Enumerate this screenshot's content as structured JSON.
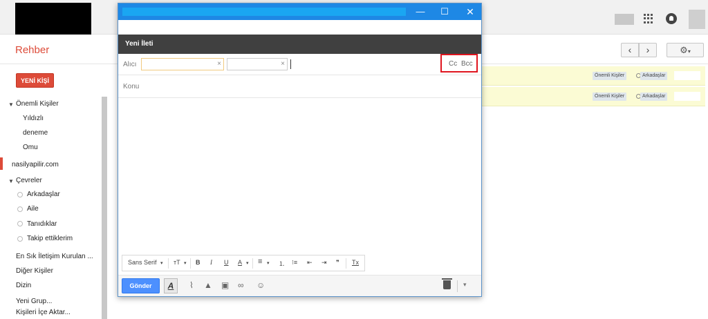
{
  "app": {
    "page_title": "Rehber",
    "new_contact_label": "YENİ KİŞİ"
  },
  "sidebar": {
    "important": {
      "label": "Önemli Kişiler",
      "children": [
        "Yıldızlı",
        "deneme",
        "Omu"
      ]
    },
    "domain_item": "nasilyapilir.com",
    "circles": {
      "label": "Çevreler",
      "children": [
        "Arkadaşlar",
        "Aile",
        "Tanıdıklar",
        "Takip ettiklerim"
      ]
    },
    "bottom_items": [
      "En Sık İletişim Kurulan ...",
      "Diğer Kişiler",
      "Dizin",
      "Yeni Grup...",
      "Kişileri İçe Aktar..."
    ]
  },
  "toolbar": {
    "prev_icon": "‹",
    "next_icon": "›",
    "settings_icon": "gear-icon",
    "settings_caret": "▾"
  },
  "contact_rows": [
    {
      "tags": [
        "Önemli Kişiler",
        "Arkadaşlar"
      ]
    },
    {
      "tags": [
        "Önemli Kişiler",
        "Arkadaşlar"
      ]
    }
  ],
  "compose": {
    "window_controls": {
      "minimize": "—",
      "maximize": "☐",
      "close": "✕"
    },
    "title": "Yeni İleti",
    "to_label": "Alıcı",
    "chip_remove": "×",
    "cc_label": "Cc",
    "bcc_label": "Bcc",
    "subject_placeholder": "Konu",
    "format": {
      "font_name": "Sans Serif",
      "caret": "▾",
      "size_icon": "тT",
      "bold": "B",
      "italic": "I",
      "underline": "U",
      "text_color": "A",
      "align": "≡",
      "numbered_list": "⒈",
      "bullet_list": "⁝≡",
      "indent_less": "⇤",
      "indent_more": "⇥",
      "quote": "❞",
      "remove_format": "Tx"
    },
    "send_label": "Gönder",
    "format_toggle": "A",
    "more_options": "▾"
  },
  "colors": {
    "accent_red": "#dd4b39",
    "send_blue": "#4d90fe",
    "compose_header": "#404040",
    "highlight_box": "#e0141e"
  }
}
